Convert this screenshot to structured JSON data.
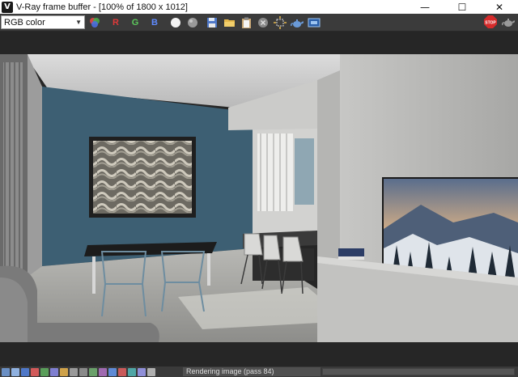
{
  "window": {
    "title": "V-Ray frame buffer - [100% of 1800 x 1012]",
    "logo": "V",
    "minimize": "—",
    "maximize": "☐",
    "close": "✕"
  },
  "toolbar": {
    "channel_value": "RGB color",
    "r_label": "R",
    "g_label": "G",
    "b_label": "B"
  },
  "status": {
    "text": "Rendering image (pass 84)",
    "progress": 0.0
  },
  "colors": {
    "toolbar_bg": "#3b3b3b",
    "viewer_bg": "#262626",
    "statusbar_bg": "#3a3a3a"
  }
}
